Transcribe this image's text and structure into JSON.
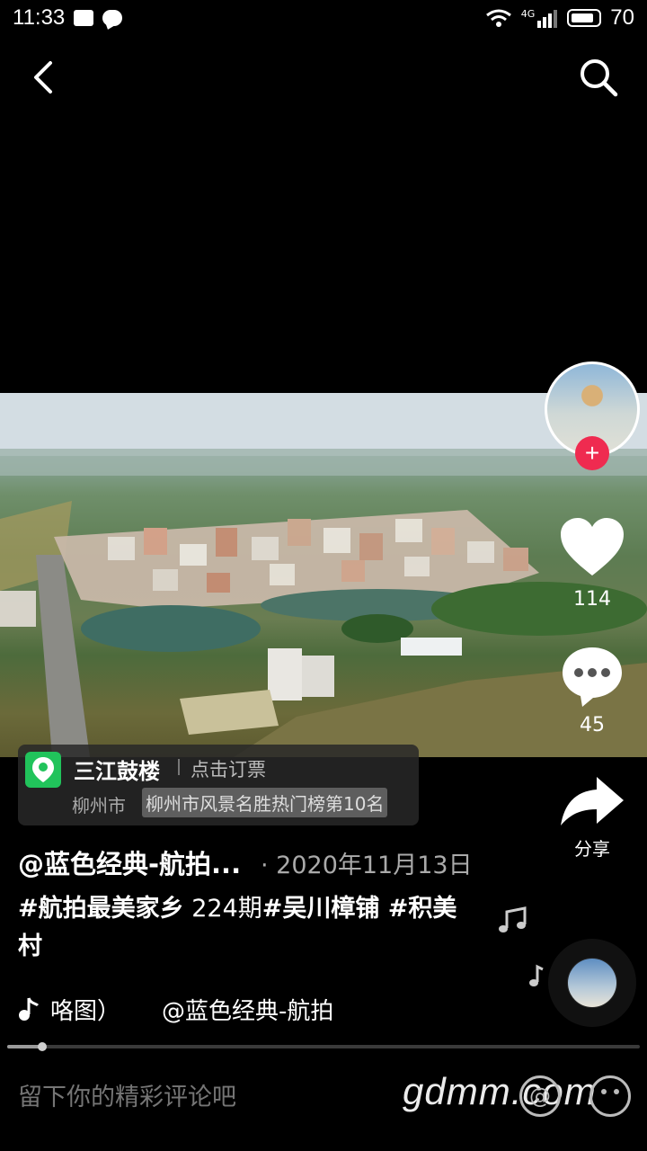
{
  "status_bar": {
    "time": "11:33",
    "network": "4G",
    "battery": "70"
  },
  "location": {
    "name": "三江鼓楼",
    "action": "点击订票",
    "city": "柳州市",
    "ranking": "柳州市风景名胜热门榜第10名"
  },
  "stats": {
    "likes": "114",
    "comments": "45",
    "share_label": "分享"
  },
  "post": {
    "author": "@蓝色经典-航拍...",
    "date": "· 2020年11月13日",
    "caption_tag_1": "#航拍最美家乡",
    "caption_middle": " 224期",
    "caption_tag_2": "#吴川樟铺 #积美村"
  },
  "music": {
    "song": "咯图）",
    "artist": "@蓝色经典-航拍"
  },
  "progress": {
    "fraction": 0.055
  },
  "comment": {
    "placeholder": "留下你的精彩评论吧"
  },
  "watermark": "gdmm.com",
  "colors": {
    "follow": "#ef2b50",
    "location_pin": "#21c35b"
  },
  "icons": {
    "back": "chevron-left-icon",
    "search": "search-icon",
    "like": "heart-icon",
    "comment": "chat-dots-icon",
    "share": "share-arrow-icon",
    "music": "music-note-icon",
    "location": "location-pin-icon"
  }
}
